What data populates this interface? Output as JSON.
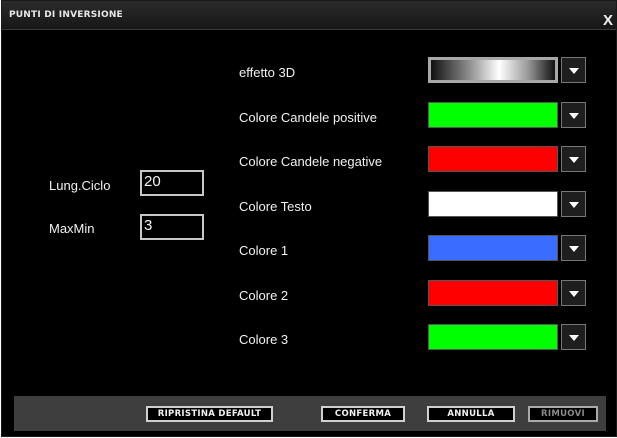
{
  "dialog": {
    "title": "PUNTI DI INVERSIONE",
    "close_label": "X"
  },
  "params": [
    {
      "label": "Lung.Ciclo",
      "value": "20"
    },
    {
      "label": "MaxMin",
      "value": "3"
    }
  ],
  "colors": [
    {
      "label": "effetto 3D",
      "swatch": "gradient",
      "dropdown_icon": "triangle-down-icon"
    },
    {
      "label": "Colore Candele positive",
      "swatch": "#00ff00",
      "dropdown_icon": "triangle-down-icon"
    },
    {
      "label": "Colore Candele negative",
      "swatch": "#ff0000",
      "dropdown_icon": "triangle-down-icon"
    },
    {
      "label": "Colore Testo",
      "swatch": "#ffffff",
      "dropdown_icon": "triangle-down-icon"
    },
    {
      "label": "Colore 1",
      "swatch": "#3a6cff",
      "dropdown_icon": "triangle-down-icon"
    },
    {
      "label": "Colore 2",
      "swatch": "#ff0000",
      "dropdown_icon": "triangle-down-icon"
    },
    {
      "label": "Colore 3",
      "swatch": "#00ff00",
      "dropdown_icon": "triangle-down-icon"
    }
  ],
  "buttons": {
    "reset": "RIPRISTINA DEFAULT",
    "confirm": "CONFERMA",
    "cancel": "ANNULLA",
    "remove": "RIMUOVI",
    "remove_disabled": true
  }
}
